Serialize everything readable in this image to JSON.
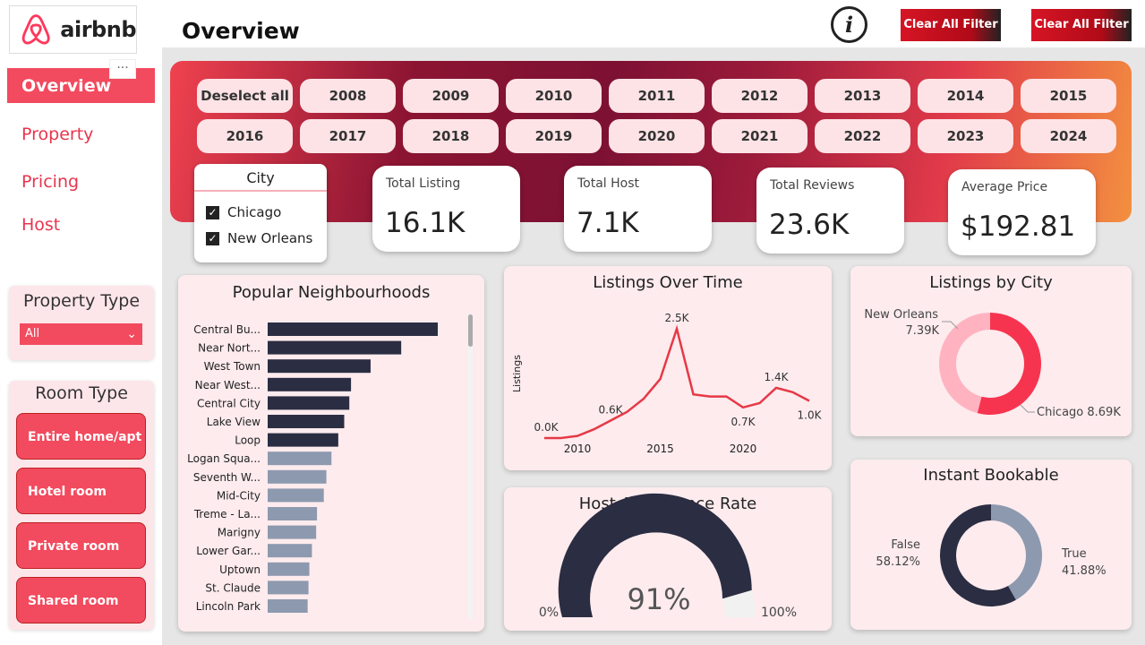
{
  "brand": {
    "name": "airbnb"
  },
  "sidebar": {
    "more": "···",
    "nav": [
      {
        "label": "Overview",
        "active": true
      },
      {
        "label": "Property"
      },
      {
        "label": "Pricing"
      },
      {
        "label": "Host"
      }
    ],
    "property_type": {
      "title": "Property Type",
      "selected": "All"
    },
    "room_type": {
      "title": "Room Type",
      "options": [
        "Entire home/apt",
        "Hotel room",
        "Private room",
        "Shared room"
      ]
    }
  },
  "header": {
    "title": "Overview",
    "info_icon": "info-icon",
    "clear_buttons": [
      "Clear All Filter",
      "Clear All Filter"
    ]
  },
  "years": [
    "Deselect all",
    "2008",
    "2009",
    "2010",
    "2011",
    "2012",
    "2013",
    "2014",
    "2015",
    "2016",
    "2017",
    "2018",
    "2019",
    "2020",
    "2021",
    "2022",
    "2023",
    "2024"
  ],
  "city_slicer": {
    "title": "City",
    "options": [
      "Chicago",
      "New Orleans"
    ]
  },
  "kpis": [
    {
      "label": "Total Listing",
      "value": "16.1K"
    },
    {
      "label": "Total Host",
      "value": "7.1K"
    },
    {
      "label": "Total Reviews",
      "value": "23.6K"
    },
    {
      "label": "Average Price",
      "value": "$192.81"
    }
  ],
  "colors": {
    "accent": "#f24a5e",
    "dark_bar": "#2b2d42",
    "light_bar": "#8d99ae",
    "line": "#e63946",
    "donut_pink": "#ffb3c1",
    "donut_red": "#f7344f"
  },
  "chart_data": [
    {
      "type": "bar",
      "title": "Popular Neighbourhoods",
      "orientation": "horizontal",
      "categories": [
        "Central Bu...",
        "Near Nort...",
        "West Town",
        "Near West...",
        "Central City",
        "Lake View",
        "Loop",
        "Logan Squa...",
        "Seventh W...",
        "Mid-City",
        "Treme - La...",
        "Marigny",
        "Lower Gar...",
        "Uptown",
        "St. Claude",
        "Lincoln Park"
      ],
      "values": [
        1000,
        785,
        605,
        490,
        480,
        450,
        415,
        375,
        345,
        330,
        290,
        285,
        260,
        245,
        240,
        235
      ],
      "highlight_count": 7
    },
    {
      "type": "line",
      "title": "Listings Over Time",
      "ylabel": "Listings",
      "x": [
        2008,
        2009,
        2010,
        2011,
        2012,
        2013,
        2014,
        2015,
        2016,
        2017,
        2018,
        2019,
        2020,
        2021,
        2022,
        2023,
        2024
      ],
      "y": [
        0.0,
        0.0,
        0.05,
        0.2,
        0.4,
        0.6,
        0.9,
        1.35,
        2.5,
        1.0,
        0.95,
        0.95,
        0.7,
        0.8,
        1.15,
        1.05,
        0.85
      ],
      "x_ticks": [
        "2010",
        "2015",
        "2020"
      ],
      "data_labels": [
        {
          "x": 2008,
          "text": "0.0K"
        },
        {
          "x": 2012,
          "text": "0.6K"
        },
        {
          "x": 2016,
          "text": "2.5K"
        },
        {
          "x": 2020,
          "text": "0.7K"
        },
        {
          "x": 2022,
          "text": "1.4K"
        },
        {
          "x": 2024,
          "text": "1.0K"
        }
      ]
    },
    {
      "type": "pie",
      "title": "Listings by City",
      "donut": true,
      "slices": [
        {
          "label": "Chicago",
          "value": 8.69,
          "display": "Chicago 8.69K"
        },
        {
          "label": "New Orleans",
          "value": 7.39,
          "display": "7.39K"
        }
      ]
    },
    {
      "type": "pie",
      "title": "Host Acceptance Rate",
      "gauge": true,
      "value": 91,
      "display": "91%",
      "min_label": "0%",
      "max_label": "100%"
    },
    {
      "type": "pie",
      "title": "Instant Bookable",
      "donut": true,
      "slices": [
        {
          "label": "False",
          "value": 58.12,
          "display": "58.12%"
        },
        {
          "label": "True",
          "value": 41.88,
          "display": "41.88%"
        }
      ]
    }
  ]
}
